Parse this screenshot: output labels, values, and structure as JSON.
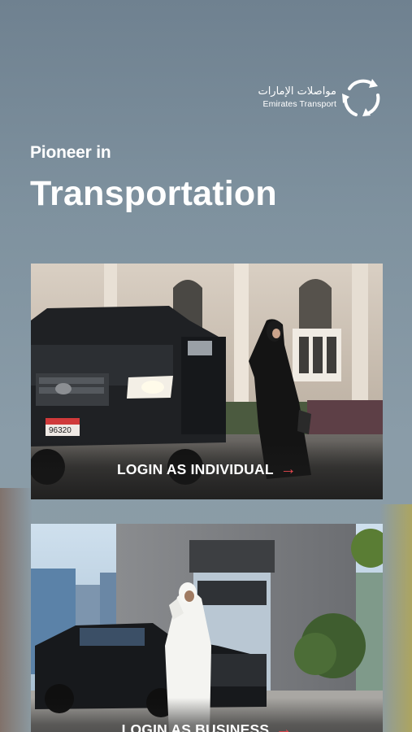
{
  "brand": {
    "name_ar": "مواصلات الإمارات",
    "name_en": "Emirates Transport",
    "logo_icon": "recycle-arrows-icon"
  },
  "hero": {
    "eyebrow": "Pioneer in",
    "headline": "Transportation"
  },
  "cards": [
    {
      "label": "LOGIN AS INDIVIDUAL",
      "arrow": "→",
      "plate": "96320"
    },
    {
      "label": "LOGIN AS BUSINESS",
      "arrow": "→"
    }
  ],
  "colors": {
    "accent_arrow": "#e8484f",
    "background_top": "#6f8190",
    "text": "#ffffff"
  }
}
